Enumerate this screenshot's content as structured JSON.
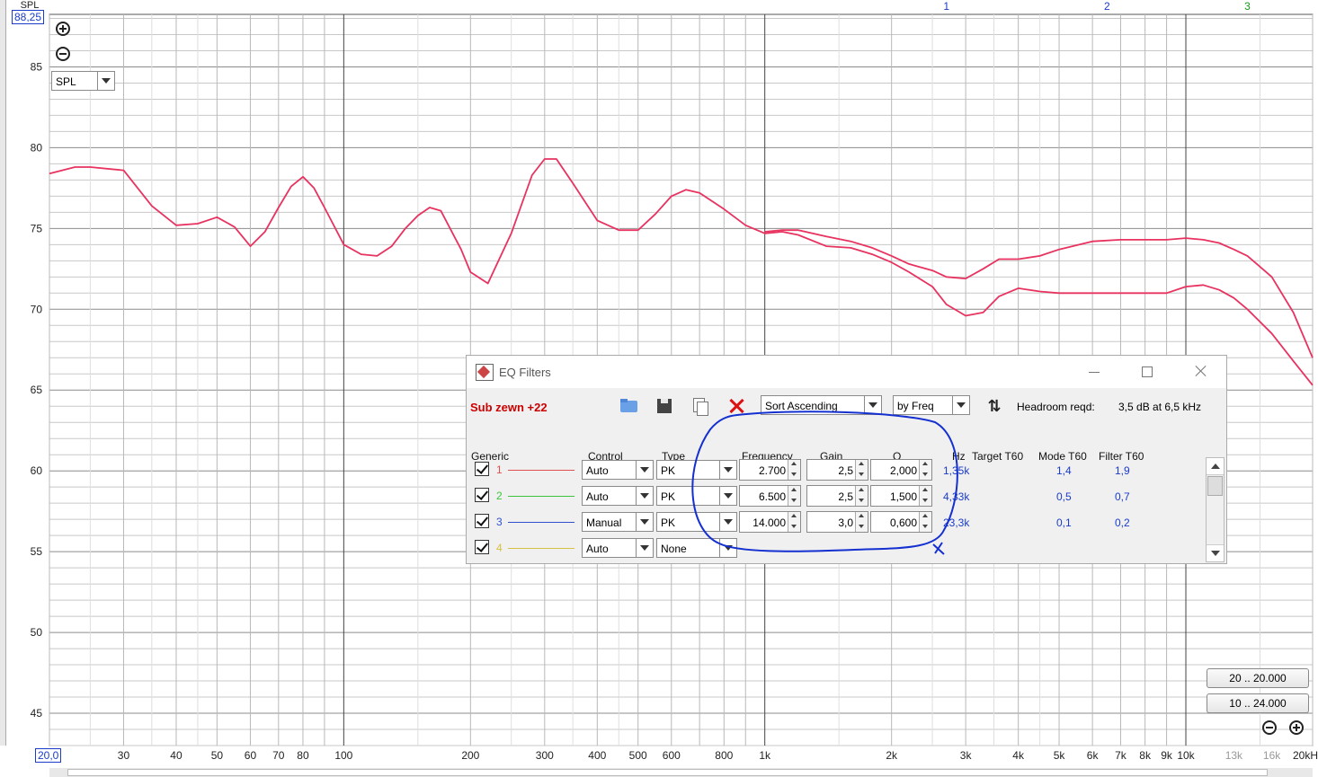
{
  "graph": {
    "y_axis_title": "SPL",
    "cursor_y_readout": "88,25",
    "cursor_x_readout": "20,0",
    "y_tick_labels": [
      "85",
      "80",
      "75",
      "70",
      "65",
      "60",
      "55",
      "50",
      "45"
    ],
    "x_tick_labels": [
      "30",
      "40",
      "50",
      "60",
      "70",
      "80",
      "100",
      "200",
      "300",
      "400",
      "500",
      "600",
      "800",
      "1k",
      "2k",
      "3k",
      "4k",
      "5k",
      "6k",
      "7k",
      "8k",
      "9k",
      "10k",
      "13k",
      "16k",
      "20kH"
    ],
    "filter_markers": [
      "1",
      "2",
      "3"
    ],
    "spl_selector": "SPL",
    "range_buttons": [
      "20 .. 20.000",
      "10 .. 24.000"
    ],
    "colors": {
      "curve": "#e8325f",
      "grid_major": "#555555",
      "grid_minor": "#c8c8c8",
      "markers_blue": "#1a3cc8",
      "marker_green": "#1a9a1a",
      "annotation": "#1530d0"
    }
  },
  "chart_data": {
    "type": "line",
    "xscale": "log",
    "xlim": [
      20,
      20000
    ],
    "ylim": [
      43,
      88.25
    ],
    "ylabel": "SPL",
    "series": [
      {
        "x": [
          20,
          23,
          25,
          30,
          35,
          40,
          45,
          50,
          55,
          60,
          65,
          70,
          75,
          80,
          85,
          90,
          100,
          110,
          120,
          130,
          140,
          150,
          160,
          170,
          190,
          200,
          220,
          250,
          280,
          300,
          320,
          350,
          400,
          450,
          500,
          550,
          600,
          650,
          700,
          800,
          900,
          1000,
          1100,
          1200,
          1400,
          1600,
          1800,
          2000,
          2200,
          2500,
          2700,
          3000,
          3300,
          3600,
          4000,
          4500,
          5000,
          6000,
          7000,
          8000,
          9000,
          10000,
          11000,
          12000,
          13000,
          14000,
          16000,
          18000,
          20000
        ],
        "y": [
          78.4,
          78.8,
          78.8,
          78.6,
          76.4,
          75.2,
          75.3,
          75.7,
          75.1,
          73.9,
          74.8,
          76.3,
          77.6,
          78.2,
          77.5,
          76.3,
          74.0,
          73.4,
          73.3,
          73.9,
          75.0,
          75.8,
          76.3,
          76.1,
          73.7,
          72.3,
          71.6,
          74.7,
          78.3,
          79.3,
          79.3,
          77.8,
          75.5,
          74.9,
          74.9,
          75.9,
          77.0,
          77.4,
          77.2,
          76.2,
          75.2,
          74.7,
          74.8,
          74.6,
          73.9,
          73.8,
          73.4,
          72.9,
          72.3,
          71.4,
          70.3,
          69.6,
          69.8,
          70.8,
          71.3,
          71.1,
          71.0,
          71.0,
          71.0,
          71.0,
          71.0,
          71.4,
          71.5,
          71.2,
          70.7,
          70.0,
          68.5,
          66.8,
          65.3
        ]
      },
      {
        "x": [
          1000,
          1100,
          1200,
          1400,
          1600,
          1800,
          2000,
          2200,
          2500,
          2700,
          3000,
          3300,
          3600,
          4000,
          4500,
          5000,
          6000,
          7000,
          8000,
          9000,
          10000,
          11000,
          12000,
          13000,
          14000,
          16000,
          18000,
          20000
        ],
        "y": [
          74.8,
          74.9,
          74.9,
          74.5,
          74.2,
          73.8,
          73.3,
          72.8,
          72.4,
          72.0,
          71.9,
          72.5,
          73.1,
          73.1,
          73.3,
          73.7,
          74.2,
          74.3,
          74.3,
          74.3,
          74.4,
          74.3,
          74.1,
          73.7,
          73.3,
          72.0,
          69.8,
          67.0
        ]
      }
    ]
  },
  "dialog": {
    "title": "EQ Filters",
    "config_name": "Sub zewn +22",
    "sort_mode": "Sort Ascending",
    "sort_by": "by Freq",
    "headroom_label": "Headroom reqd:",
    "headroom_value": "3,5 dB at 6,5 kHz",
    "columns": [
      "Generic",
      "Control",
      "Type",
      "Frequency",
      "Gain",
      "Q",
      "Hz",
      "Target T60",
      "Mode T60",
      "Filter T60"
    ],
    "rows": [
      {
        "num": "1",
        "color": "#e05050",
        "control": "Auto",
        "type": "PK",
        "frequency": "2.700",
        "gain": "2,5",
        "q": "2,000",
        "hz": "1,35k",
        "mode_t60": "1,4",
        "filter_t60": "1,9"
      },
      {
        "num": "2",
        "color": "#3cc43c",
        "control": "Auto",
        "type": "PK",
        "frequency": "6.500",
        "gain": "2,5",
        "q": "1,500",
        "hz": "4,33k",
        "mode_t60": "0,5",
        "filter_t60": "0,7"
      },
      {
        "num": "3",
        "color": "#3050d0",
        "control": "Manual",
        "type": "PK",
        "frequency": "14.000",
        "gain": "3,0",
        "q": "0,600",
        "hz": "23,3k",
        "mode_t60": "0,1",
        "filter_t60": "0,2"
      },
      {
        "num": "4",
        "color": "#d8c040",
        "control": "Auto",
        "type": "None"
      }
    ]
  }
}
